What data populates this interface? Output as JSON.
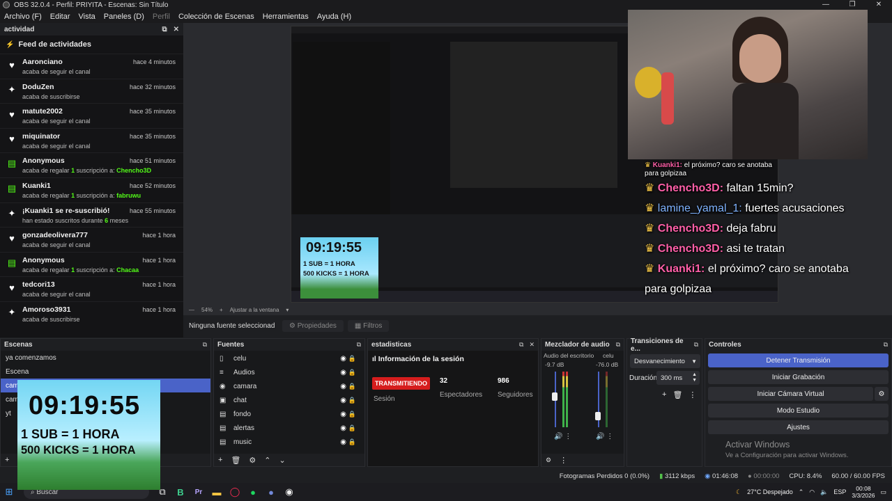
{
  "window": {
    "title": "OBS 32.0.4 - Perfil: PRIYITA - Escenas: Sin Título",
    "min": "—",
    "max": "❐",
    "close": "✕"
  },
  "menu": [
    "Archivo (F)",
    "Editar",
    "Vista",
    "Paneles (D)",
    "Perfil",
    "Colección de Escenas",
    "Herramientas",
    "Ayuda (H)"
  ],
  "activity": {
    "header": "actividad",
    "feed_title": "Feed de actividades",
    "items": [
      {
        "icon": "heart-icon",
        "name": "Aaronciano",
        "time": "hace 4 minutos",
        "pre": "acaba de seguir el canal",
        "hl": "",
        "post": ""
      },
      {
        "icon": "sparkle-icon",
        "name": "DoduZen",
        "time": "hace 32 minutos",
        "pre": "acaba de suscribirse",
        "hl": "",
        "post": ""
      },
      {
        "icon": "heart-icon",
        "name": "matute2002",
        "time": "hace 35 minutos",
        "pre": "acaba de seguir el canal",
        "hl": "",
        "post": ""
      },
      {
        "icon": "heart-icon",
        "name": "miquinator",
        "time": "hace 35 minutos",
        "pre": "acaba de seguir el canal",
        "hl": "",
        "post": ""
      },
      {
        "icon": "gift-icon",
        "name": "Anonymous",
        "time": "hace 51 minutos",
        "pre": "acaba de regalar ",
        "hl": "1",
        "post": " suscripción a: ",
        "hl2": "Chencho3D"
      },
      {
        "icon": "gift-icon",
        "name": "Kuanki1",
        "time": "hace 52 minutos",
        "pre": "acaba de regalar ",
        "hl": "1",
        "post": " suscripción a: ",
        "hl2": "fabruwu"
      },
      {
        "icon": "sparkle-icon",
        "name": "¡Kuanki1 se re-suscribió!",
        "time": "hace 55 minutos",
        "pre": "han estado suscritos durante ",
        "hl": "6",
        "post": " meses"
      },
      {
        "icon": "heart-icon",
        "name": "gonzadeolivera777",
        "time": "hace 1 hora",
        "pre": "acaba de seguir el canal",
        "hl": "",
        "post": ""
      },
      {
        "icon": "gift-icon",
        "name": "Anonymous",
        "time": "hace 1 hora",
        "pre": "acaba de regalar ",
        "hl": "1",
        "post": " suscripción a: ",
        "hl2": "Chacaa"
      },
      {
        "icon": "heart-icon",
        "name": "tedcori13",
        "time": "hace 1 hora",
        "pre": "acaba de seguir el canal",
        "hl": "",
        "post": ""
      },
      {
        "icon": "sparkle-icon",
        "name": "Amoroso3931",
        "time": "hace 1 hora",
        "pre": "acaba de suscribirse",
        "hl": "",
        "post": ""
      }
    ]
  },
  "chat": [
    {
      "user": "Kuanki1:",
      "msg": " el próximo? caro se anotaba",
      "small": true
    },
    {
      "user": "para golpizaa",
      "msg": "",
      "plain": true,
      "small": true
    },
    {
      "user": "Chencho3D:",
      "msg": " faltan 15min?"
    },
    {
      "user": "lamine_yamal_1:",
      "msg": " fuertes acusaciones",
      "blue": true
    },
    {
      "user": "Chencho3D:",
      "msg": " deja fabru"
    },
    {
      "user": "Chencho3D:",
      "msg": " asi te tratan"
    },
    {
      "user": "Kuanki1:",
      "msg": " el próximo? caro se anotaba"
    },
    {
      "user": "para golpizaa",
      "msg": "",
      "plain": true
    }
  ],
  "timer": {
    "time": "09:19:55",
    "line1": "1 SUB = 1 HORA",
    "line2": "500 KICKS = 1 HORA"
  },
  "preview_footer": {
    "zoom": "54%",
    "fit": "Ajustar a la ventana"
  },
  "source_bar": {
    "no_source": "Ninguna fuente seleccionad",
    "props": "Propiedades",
    "filters": "Filtros"
  },
  "scenes": {
    "title": "Escenas",
    "items": [
      "ya comenzamos",
      "Escena",
      "camara",
      "camara 2",
      "yt"
    ],
    "selected": 2
  },
  "sources": {
    "title": "Fuentes",
    "items": [
      {
        "icon": "▯",
        "name": "celu"
      },
      {
        "icon": "≡",
        "name": "Audios"
      },
      {
        "icon": "◉",
        "name": "camara"
      },
      {
        "icon": "▣",
        "name": "chat"
      },
      {
        "icon": "▤",
        "name": "fondo"
      },
      {
        "icon": "▤",
        "name": "alertas"
      },
      {
        "icon": "▤",
        "name": "music"
      }
    ]
  },
  "stats": {
    "title": "estadisticas",
    "heading": "Información de la sesión",
    "badge": "TRANSMITIENDO",
    "session": "Sesión",
    "viewers_num": "32",
    "viewers_lbl": "Espectadores",
    "followers_num": "986",
    "followers_lbl": "Seguidores"
  },
  "mixer": {
    "title": "Mezclador de audio",
    "ch1": "Audio del escritorio",
    "ch1_db": "-9.7 dB",
    "ch2": "celu",
    "ch2_db": "-76.0 dB",
    "ch1_level": 0.55,
    "ch2_level": 0.2
  },
  "transitions": {
    "title": "Transiciones de e...",
    "selected": "Desvanecimiento",
    "duration_label": "Duración",
    "duration": "300 ms"
  },
  "controls": {
    "title": "Controles",
    "stop_stream": "Detener Transmisión",
    "start_rec": "Iniciar Grabación",
    "virtual_cam": "Iniciar Cámara Virtual",
    "studio": "Modo Estudio",
    "settings": "Ajustes"
  },
  "watermark": {
    "line1": "Activar Windows",
    "line2": "Ve a Configuración para activar Windows."
  },
  "status": {
    "dropped": "Fotogramas Perdidos 0 (0.0%)",
    "bitrate": "3112 kbps",
    "stream_time": "01:46:08",
    "rec_time": "00:00:00",
    "cpu": "CPU: 8.4%",
    "fps": "60.00 / 60.00 FPS"
  },
  "taskbar": {
    "search": "Buscar",
    "weather": "27°C  Despejado",
    "lang": "ESP",
    "time": "00:08",
    "date": "3/3/2026"
  }
}
